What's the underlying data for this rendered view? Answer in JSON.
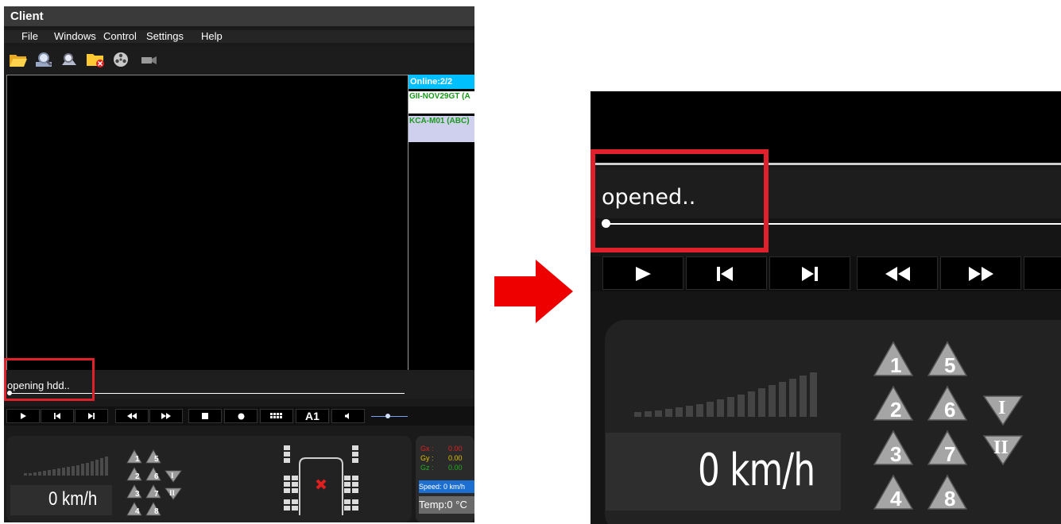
{
  "window": {
    "title": "Client"
  },
  "menu": [
    "File",
    "Windows",
    "Control",
    "Settings",
    "Help"
  ],
  "toolbar": {
    "icons": [
      "open-folder-icon",
      "search-icon",
      "search-settings-icon",
      "folder-delete-icon",
      "film-reel-icon",
      "camera-icon"
    ]
  },
  "device_panel": {
    "online": "Online:2/2",
    "devices": [
      "GII-NOV29GT (A",
      "KCA-M01 (ABC)"
    ]
  },
  "status": {
    "left_text": "opening hdd..",
    "zoom_text": "opened.."
  },
  "controls": {
    "buttons": [
      "play-icon",
      "previous-icon",
      "next-icon",
      "rewind-icon",
      "fast-forward-icon",
      "stop-icon",
      "record-icon",
      "grid-icon",
      "a1",
      "volume-icon"
    ],
    "a1_label": "A1"
  },
  "dashboard": {
    "speed": "0 km/h",
    "channels": [
      "1",
      "5",
      "2",
      "6",
      "3",
      "7",
      "4",
      "8"
    ],
    "roman": [
      "I",
      "II"
    ]
  },
  "sensor": {
    "rows": [
      {
        "label": "Gx :",
        "value": "0.00"
      },
      {
        "label": "Gy :",
        "value": "0.00"
      },
      {
        "label": "Gz :",
        "value": "0.00"
      }
    ],
    "speed": "Speed: 0 km/h",
    "temp": "Temp:0 °C"
  },
  "colors": {
    "highlight": "#e0202a",
    "online_bg": "#00bfff",
    "device_text": "#1a9a1a",
    "arrow": "#ee0000"
  }
}
